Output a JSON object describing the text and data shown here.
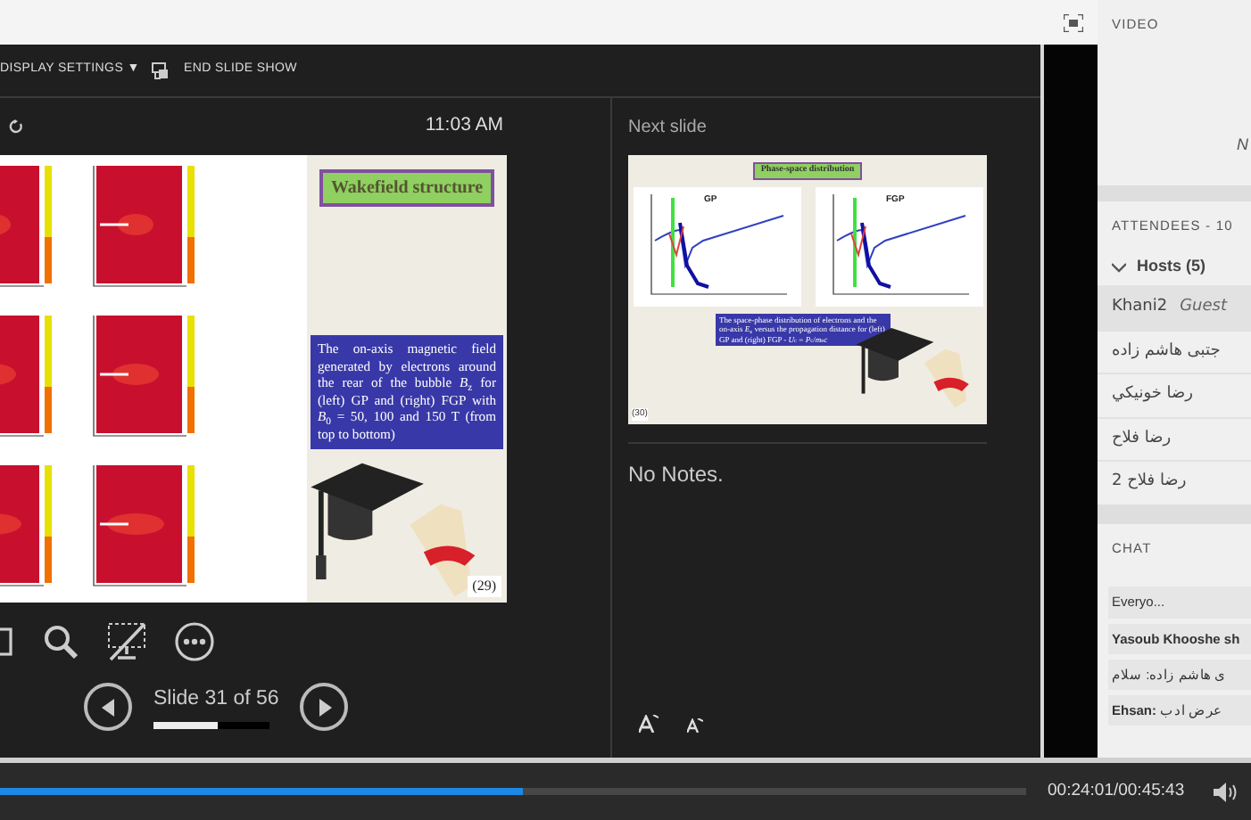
{
  "toolbar": {
    "display_settings": "DISPLAY SETTINGS ▼",
    "end_slide_show": "END SLIDE SHOW"
  },
  "presenter": {
    "clock": "11:03 AM",
    "current_slide": {
      "title": "Wakefield structure",
      "caption": "The on-axis magnetic field generated by electrons around the rear of the bubble *B*$_{z}$ for (left) GP and (right) FGP with *B*$_{0}$ = 50, 100 and 150 T (from top to bottom)",
      "page": "(29)"
    },
    "slide_label": "Slide 31 of 56",
    "level": 0.55
  },
  "next_slide": {
    "label": "Next slide",
    "title": "Phase-space distribution",
    "plot_labels": [
      "GP",
      "FGP"
    ],
    "caption": "The space-phase distribution of electrons and the on-axis *E*$_{z}$ versus the propagation distance for (left) GP and (right) FGP - *U*$_{c}$ = *P*$_{c}$/*m*$_{e}$*c*",
    "page": "(30)"
  },
  "notes": "No Notes.",
  "sidebar": {
    "video": {
      "header": "VIDEO",
      "text": "N"
    },
    "attendees": {
      "header": "ATTENDEES - 10",
      "group": {
        "label": "Hosts (5)",
        "expanded": true
      },
      "members": [
        {
          "name": "Khani2",
          "role": "Guest",
          "selected": true
        },
        {
          "name": "جتبی هاشم زاده",
          "selected": false
        },
        {
          "name": "رضا خونیکي",
          "selected": false
        },
        {
          "name": "رضا فلاح",
          "selected": false
        },
        {
          "name": "رضا فلاح 2",
          "selected": false
        }
      ]
    },
    "chat": {
      "header": "CHAT",
      "messages": [
        {
          "text": "Everyo..."
        },
        {
          "sender": "Yasoub Khooshe sh"
        },
        {
          "text": "ی هاشم زاده: سلام"
        },
        {
          "sender": "Ehsan:",
          "text": "عرض ادب"
        }
      ]
    }
  },
  "player": {
    "level": 0.51,
    "time": "00:24:01/00:45:43"
  }
}
